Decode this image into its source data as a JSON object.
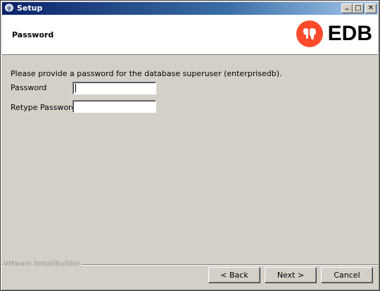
{
  "window": {
    "title": "Setup",
    "minimize_glyph": "_",
    "maximize_glyph": "□",
    "close_glyph": "✕"
  },
  "header": {
    "title": "Password",
    "logo_text": "EDB",
    "logo_color": "#ff4b2b",
    "logo_icon": "edb-elephant-logo-icon"
  },
  "form": {
    "prompt": "Please provide a password for the database superuser (enterprisedb).",
    "password_label": "Password",
    "password_value": "",
    "retype_label": "Retype Password",
    "retype_value": ""
  },
  "footer": {
    "brand": "VMware InstallBuilder",
    "back_label": "< Back",
    "next_label": "Next >",
    "cancel_label": "Cancel"
  }
}
